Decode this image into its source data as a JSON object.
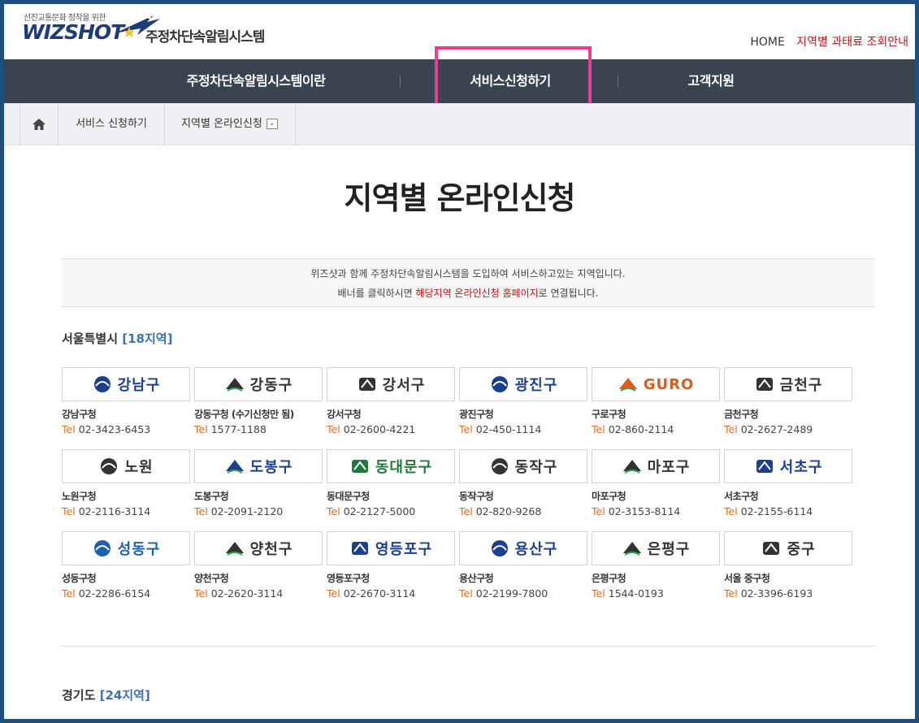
{
  "header": {
    "logo_tagline": "선진교통문화 정착을 위한",
    "logo_brand": "WIZSHOT",
    "logo_system": "주정차단속알림시스템",
    "util_home": "HOME",
    "util_fee": "지역별 과태료 조회안내"
  },
  "nav": {
    "items": [
      {
        "label": "주정차단속알림시스템이란"
      },
      {
        "label": "서비스신청하기"
      },
      {
        "label": "고객지원"
      }
    ]
  },
  "breadcrumb": {
    "level1": "서비스 신청하기",
    "level2": "지역별 온라인신청"
  },
  "page": {
    "title": "지역별 온라인신청",
    "notice_line1": "위즈샷과 함께 주정차단속알림시스템을 도입하여 서비스하고있는 지역입니다.",
    "notice_line2_pre": "배너를 클릭하시면 ",
    "notice_line2_red": "해당지역 온라인신청 홈페이지",
    "notice_line2_post": "로 연결됩니다."
  },
  "sections": {
    "seoul": {
      "name": "서울특별시",
      "count": "[18지역]"
    },
    "gyeonggi": {
      "name": "경기도",
      "count": "[24지역]"
    }
  },
  "tel_label": "Tel",
  "colors": {
    "nav_bg": "#3a4350",
    "accent_red": "#c0141c",
    "tel_orange": "#e06b1f",
    "count_blue": "#3d72b8",
    "highlight": "#ea3c96"
  },
  "offices": [
    {
      "banner": "강남구",
      "name": "강남구청",
      "tel": "02-3423-6453",
      "color": "#1d3f8f",
      "icon": "gangnam-logo-icon"
    },
    {
      "banner": "강동구",
      "name": "강동구청 (수기신청만 됨)",
      "tel": "1577-1188",
      "color": "#333333",
      "icon": "gangdong-logo-icon"
    },
    {
      "banner": "강서구",
      "name": "강서구청",
      "tel": "02-2600-4221",
      "color": "#333333",
      "icon": "gangseo-logo-icon"
    },
    {
      "banner": "광진구",
      "name": "광진구청",
      "tel": "02-450-1114",
      "color": "#1d3f8f",
      "icon": "gwangjin-logo-icon"
    },
    {
      "banner": "GURO",
      "name": "구로구청",
      "tel": "02-860-2114",
      "color": "#e05a1e",
      "icon": "guro-logo-icon"
    },
    {
      "banner": "금천구",
      "name": "금천구청",
      "tel": "02-2627-2489",
      "color": "#333333",
      "icon": "geumcheon-logo-icon"
    },
    {
      "banner": "노원",
      "name": "노원구청",
      "tel": "02-2116-3114",
      "color": "#333333",
      "icon": "nowon-logo-icon"
    },
    {
      "banner": "도봉구",
      "name": "도봉구청",
      "tel": "02-2091-2120",
      "color": "#1d3f8f",
      "icon": "dobong-logo-icon"
    },
    {
      "banner": "동대문구",
      "name": "동대문구청",
      "tel": "02-2127-5000",
      "color": "#1f7a3a",
      "icon": "dongdaemun-logo-icon"
    },
    {
      "banner": "동작구",
      "name": "동작구청",
      "tel": "02-820-9268",
      "color": "#333333",
      "icon": "dongjak-logo-icon"
    },
    {
      "banner": "마포구",
      "name": "마포구청",
      "tel": "02-3153-8114",
      "color": "#333333",
      "icon": "mapo-logo-icon"
    },
    {
      "banner": "서초구",
      "name": "서초구청",
      "tel": "02-2155-6114",
      "color": "#1d3f8f",
      "icon": "seocho-logo-icon"
    },
    {
      "banner": "성동구",
      "name": "성동구청",
      "tel": "02-2286-6154",
      "color": "#1d5fb0",
      "icon": "seongdong-logo-icon"
    },
    {
      "banner": "양천구",
      "name": "양천구청",
      "tel": "02-2620-3114",
      "color": "#333333",
      "icon": "yangcheon-logo-icon"
    },
    {
      "banner": "영등포구",
      "name": "영등포구청",
      "tel": "02-2670-3114",
      "color": "#1d3f8f",
      "icon": "yeongdeungpo-logo-icon"
    },
    {
      "banner": "용산구",
      "name": "용산구청",
      "tel": "02-2199-7800",
      "color": "#1d3f8f",
      "icon": "yongsan-logo-icon"
    },
    {
      "banner": "은평구",
      "name": "은평구청",
      "tel": "1544-0193",
      "color": "#333333",
      "icon": "eunpyeong-logo-icon"
    },
    {
      "banner": "중구",
      "name": "서울 중구청",
      "tel": "02-3396-6193",
      "color": "#333333",
      "icon": "junggu-logo-icon"
    }
  ]
}
